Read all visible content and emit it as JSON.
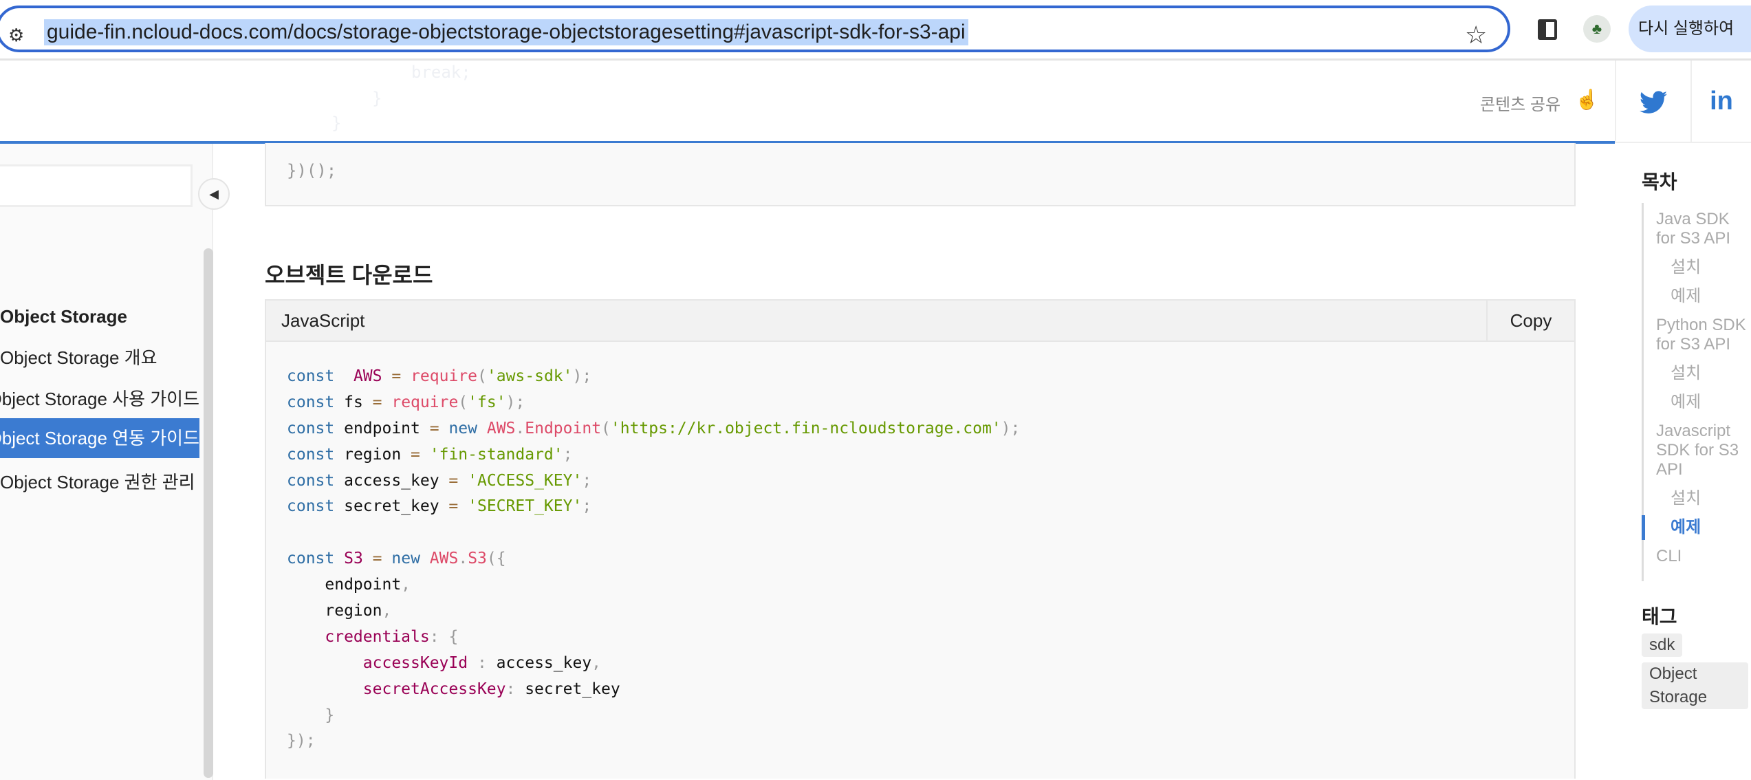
{
  "browser": {
    "url": "guide-fin.ncloud-docs.com/docs/storage-objectstorage-objectstoragesetting#javascript-sdk-for-s3-api",
    "relaunch_label": "다시 실행하여 ",
    "icons": {
      "site_info": "tune-icon",
      "bookmark": "star-icon",
      "side_panel": "side-panel-icon",
      "profile": "avatar"
    }
  },
  "header": {
    "ghost_code": [
      "break;",
      "}",
      "}"
    ],
    "share_label": "콘텐츠 공유",
    "social": [
      "twitter",
      "linkedin"
    ],
    "linkedin_label": "in"
  },
  "sidebar": {
    "search_placeholder": "",
    "items": [
      {
        "label": "Object Storage",
        "bold": true
      },
      {
        "label": "Object Storage 개요"
      },
      {
        "label": "Object Storage 사용 가이드"
      },
      {
        "label": "Object Storage 연동 가이드",
        "selected": true
      },
      {
        "label": "Object Storage 권한 관리"
      }
    ]
  },
  "main": {
    "prev_code": "})();",
    "heading": "오브젝트 다운로드",
    "code_block": {
      "language": "JavaScript",
      "copy_label": "Copy",
      "lines": [
        [
          [
            "kw",
            "const"
          ],
          [
            "",
            "  "
          ],
          [
            "var",
            "AWS"
          ],
          [
            "",
            " "
          ],
          [
            "op",
            "="
          ],
          [
            "",
            " "
          ],
          [
            "fn",
            "require"
          ],
          [
            "pun",
            "("
          ],
          [
            "str",
            "'aws-sdk'"
          ],
          [
            "pun",
            ");"
          ]
        ],
        [
          [
            "kw",
            "const"
          ],
          [
            "",
            " fs "
          ],
          [
            "op",
            "="
          ],
          [
            "",
            " "
          ],
          [
            "fn",
            "require"
          ],
          [
            "pun",
            "("
          ],
          [
            "str",
            "'fs'"
          ],
          [
            "pun",
            ");"
          ]
        ],
        [
          [
            "kw",
            "const"
          ],
          [
            "",
            " endpoint "
          ],
          [
            "op",
            "="
          ],
          [
            "",
            " "
          ],
          [
            "kw",
            "new"
          ],
          [
            "",
            " "
          ],
          [
            "fn",
            "AWS"
          ],
          [
            "pun",
            "."
          ],
          [
            "fn",
            "Endpoint"
          ],
          [
            "pun",
            "("
          ],
          [
            "str",
            "'https://kr.object.fin-ncloudstorage.com'"
          ],
          [
            "pun",
            ");"
          ]
        ],
        [
          [
            "kw",
            "const"
          ],
          [
            "",
            " region "
          ],
          [
            "op",
            "="
          ],
          [
            "",
            " "
          ],
          [
            "str",
            "'fin-standard'"
          ],
          [
            "pun",
            ";"
          ]
        ],
        [
          [
            "kw",
            "const"
          ],
          [
            "",
            " access_key "
          ],
          [
            "op",
            "="
          ],
          [
            "",
            " "
          ],
          [
            "str",
            "'ACCESS_KEY'"
          ],
          [
            "pun",
            ";"
          ]
        ],
        [
          [
            "kw",
            "const"
          ],
          [
            "",
            " secret_key "
          ],
          [
            "op",
            "="
          ],
          [
            "",
            " "
          ],
          [
            "str",
            "'SECRET_KEY'"
          ],
          [
            "pun",
            ";"
          ]
        ],
        [],
        [
          [
            "kw",
            "const"
          ],
          [
            "",
            " "
          ],
          [
            "var",
            "S3"
          ],
          [
            "",
            " "
          ],
          [
            "op",
            "="
          ],
          [
            "",
            " "
          ],
          [
            "kw",
            "new"
          ],
          [
            "",
            " "
          ],
          [
            "fn",
            "AWS"
          ],
          [
            "pun",
            "."
          ],
          [
            "fn",
            "S3"
          ],
          [
            "pun",
            "({"
          ]
        ],
        [
          [
            "",
            "    endpoint"
          ],
          [
            "pun",
            ","
          ]
        ],
        [
          [
            "",
            "    region"
          ],
          [
            "pun",
            ","
          ]
        ],
        [
          [
            "",
            "    "
          ],
          [
            "prop",
            "credentials"
          ],
          [
            "pun",
            ":"
          ],
          [
            "",
            " "
          ],
          [
            "pun",
            "{"
          ]
        ],
        [
          [
            "",
            "        "
          ],
          [
            "prop",
            "accessKeyId"
          ],
          [
            "",
            " "
          ],
          [
            "pun",
            ":"
          ],
          [
            "",
            " access_key"
          ],
          [
            "pun",
            ","
          ]
        ],
        [
          [
            "",
            "        "
          ],
          [
            "prop",
            "secretAccessKey"
          ],
          [
            "pun",
            ":"
          ],
          [
            "",
            " secret_key"
          ]
        ],
        [
          [
            "",
            "    "
          ],
          [
            "pun",
            "}"
          ]
        ],
        [
          [
            "pun",
            "});"
          ]
        ]
      ]
    }
  },
  "toc": {
    "title": "목차",
    "items": [
      {
        "label": "Java SDK for S3 API",
        "level": 1
      },
      {
        "label": "설치",
        "level": 2
      },
      {
        "label": "예제",
        "level": 2
      },
      {
        "label": "Python SDK for S3 API",
        "level": 1
      },
      {
        "label": "설치",
        "level": 2
      },
      {
        "label": "예제",
        "level": 2
      },
      {
        "label": "Javascript SDK for S3 API",
        "level": 1
      },
      {
        "label": "설치",
        "level": 2
      },
      {
        "label": "예제",
        "level": 2,
        "active": true
      },
      {
        "label": "CLI",
        "level": 1
      }
    ],
    "tags_title": "태그",
    "tags": [
      "sdk",
      "Object Storage"
    ]
  },
  "colors": {
    "accent": "#3b7bd1",
    "url_highlight": "#bcd6fb",
    "relaunch_bg": "#d3e3fd"
  }
}
